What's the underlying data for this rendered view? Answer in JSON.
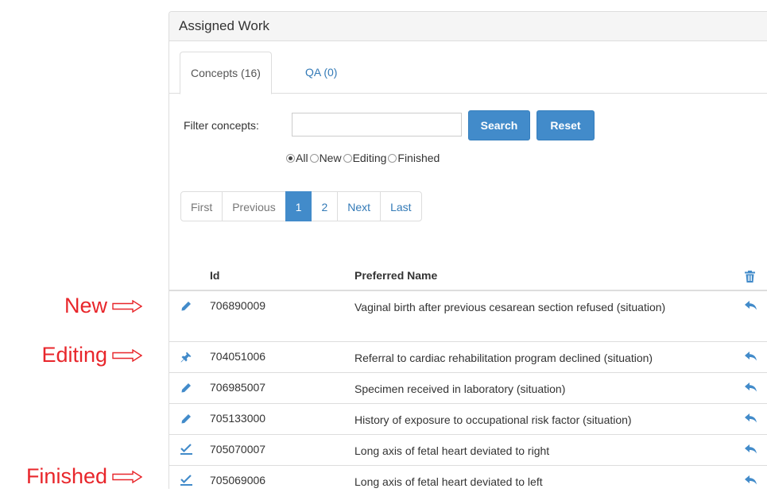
{
  "annotations": [
    {
      "label": "New"
    },
    {
      "label": "Editing"
    },
    {
      "label": "Finished"
    }
  ],
  "panel": {
    "title": "Assigned Work"
  },
  "tabs": [
    {
      "label": "Concepts (16)",
      "active": true
    },
    {
      "label": "QA (0)",
      "active": false
    }
  ],
  "filter": {
    "label": "Filter concepts:",
    "value": "",
    "placeholder": "",
    "search_label": "Search",
    "reset_label": "Reset"
  },
  "radios": [
    {
      "label": "All",
      "checked": true
    },
    {
      "label": "New",
      "checked": false
    },
    {
      "label": "Editing",
      "checked": false
    },
    {
      "label": "Finished",
      "checked": false
    }
  ],
  "pagination": {
    "first": "First",
    "previous": "Previous",
    "pages": [
      "1",
      "2"
    ],
    "current": "1",
    "next": "Next",
    "last": "Last"
  },
  "table": {
    "headers": {
      "id": "Id",
      "name": "Preferred Name",
      "action_icon": "trash-icon"
    },
    "rows": [
      {
        "status_icon": "pencil-icon",
        "id": "706890009",
        "name": "Vaginal birth after previous cesarean section refused (situation)"
      },
      {
        "status_icon": "pushpin-icon",
        "id": "704051006",
        "name": "Referral to cardiac rehabilitation program declined (situation)"
      },
      {
        "status_icon": "pencil-icon",
        "id": "706985007",
        "name": "Specimen received in laboratory (situation)"
      },
      {
        "status_icon": "pencil-icon",
        "id": "705133000",
        "name": "History of exposure to occupational risk factor (situation)"
      },
      {
        "status_icon": "check-underline-icon",
        "id": "705070007",
        "name": "Long axis of fetal heart deviated to right"
      },
      {
        "status_icon": "check-underline-icon",
        "id": "705069006",
        "name": "Long axis of fetal heart deviated to left"
      }
    ],
    "row_action_icon": "share-back-icon"
  },
  "colors": {
    "annotation": "#e8262b",
    "primary": "#428bca",
    "link": "#337ab7",
    "border": "#dddddd"
  }
}
